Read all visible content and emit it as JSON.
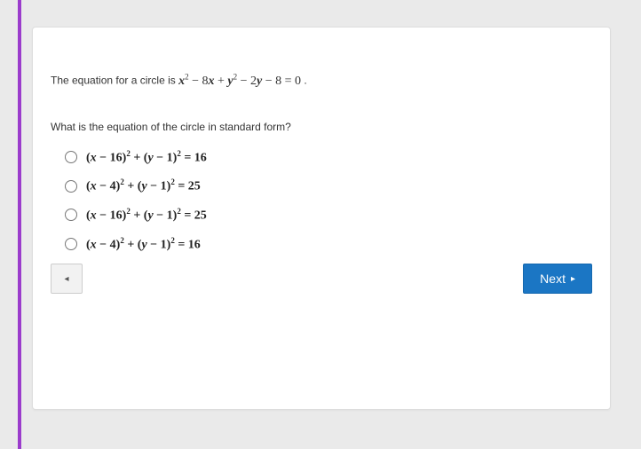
{
  "prompt_prefix": "The equation for a circle is ",
  "equation_html": "<span class='var'>x</span><span class='sup'>2</span> &minus; 8<span class='var'>x</span> + <span class='var'>y</span><span class='sup'>2</span> &minus; 2<span class='var'>y</span> &minus; 8 = 0",
  "prompt_suffix": " .",
  "question": "What is the equation of the circle in standard form?",
  "choices": [
    "(<span class='var'>x</span> &minus; 16)<span class='sup'>2</span> + (<span class='var'>y</span> &minus; 1)<span class='sup'>2</span> = 16",
    "(<span class='var'>x</span> &minus; 4)<span class='sup'>2</span> + (<span class='var'>y</span> &minus; 1)<span class='sup'>2</span> = 25",
    "(<span class='var'>x</span> &minus; 16)<span class='sup'>2</span> + (<span class='var'>y</span> &minus; 1)<span class='sup'>2</span> = 25",
    "(<span class='var'>x</span> &minus; 4)<span class='sup'>2</span> + (<span class='var'>y</span> &minus; 1)<span class='sup'>2</span> = 16"
  ],
  "nav": {
    "prev_glyph": "◂",
    "next_label": "Next",
    "next_glyph": "▸"
  },
  "colors": {
    "accent": "#9b3ccc",
    "primary": "#1b76c4"
  }
}
